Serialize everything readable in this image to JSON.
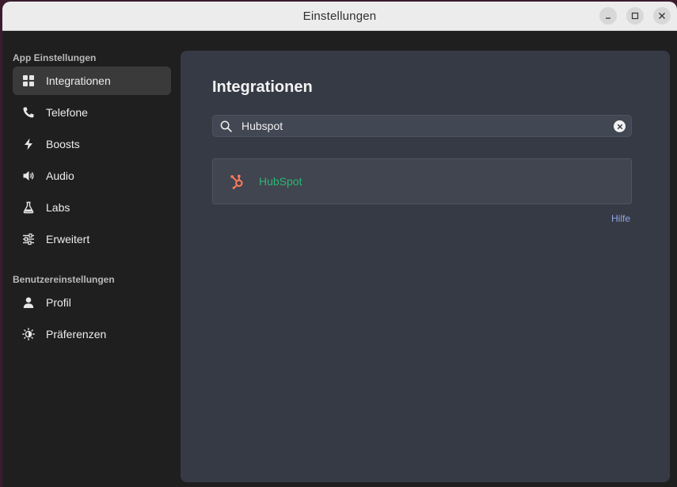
{
  "window": {
    "title": "Einstellungen"
  },
  "sidebar": {
    "app_section": "App Einstellungen",
    "app_items": [
      {
        "label": "Integrationen",
        "icon": "grid-icon",
        "active": true
      },
      {
        "label": "Telefone",
        "icon": "phone-icon"
      },
      {
        "label": "Boosts",
        "icon": "lightning-icon"
      },
      {
        "label": "Audio",
        "icon": "speaker-icon"
      },
      {
        "label": "Labs",
        "icon": "flask-icon"
      },
      {
        "label": "Erweitert",
        "icon": "sliders-icon"
      }
    ],
    "user_section": "Benutzereinstellungen",
    "user_items": [
      {
        "label": "Profil",
        "icon": "person-icon"
      },
      {
        "label": "Präferenzen",
        "icon": "sun-settings-icon"
      }
    ]
  },
  "main": {
    "title": "Integrationen",
    "search": {
      "value": "Hubspot",
      "icon": "search-icon"
    },
    "results": [
      {
        "name": "HubSpot",
        "icon": "hubspot-logo",
        "color": "#2bb673"
      }
    ],
    "help_label": "Hilfe"
  },
  "colors": {
    "accent_green": "#2bb673",
    "link": "#8fa6e6",
    "hubspot_orange": "#ff7a59"
  }
}
